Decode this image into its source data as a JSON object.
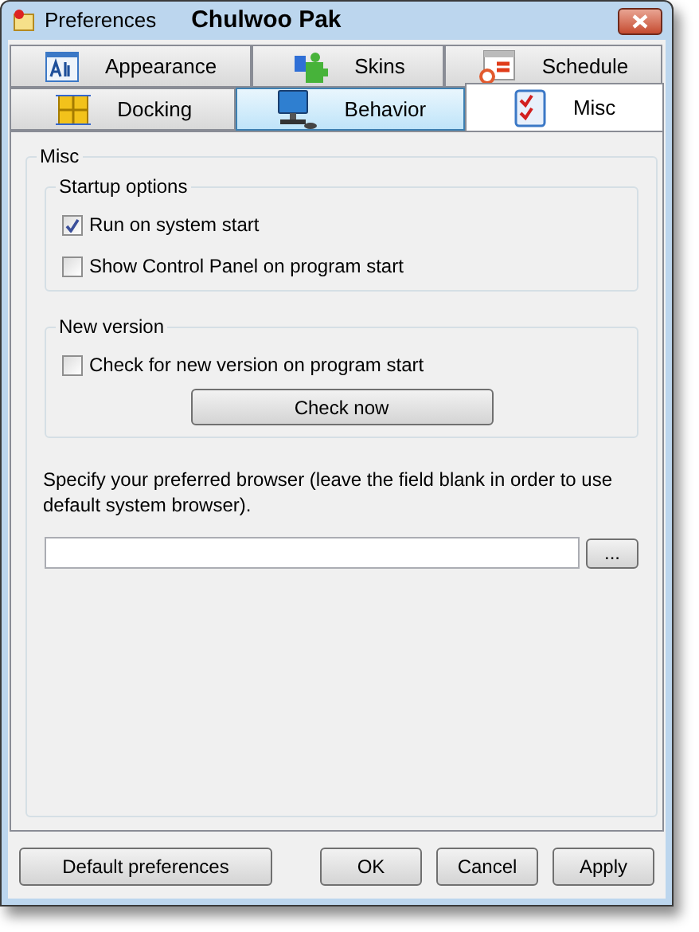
{
  "window": {
    "title": "Preferences",
    "caption": "Chulwoo Pak"
  },
  "tab_rows": [
    [
      {
        "label": "Appearance",
        "selected": false,
        "highlighted": false
      },
      {
        "label": "Skins",
        "selected": false,
        "highlighted": false
      },
      {
        "label": "Schedule",
        "selected": false,
        "highlighted": false
      }
    ],
    [
      {
        "label": "Docking",
        "selected": false,
        "highlighted": false
      },
      {
        "label": "Behavior",
        "selected": false,
        "highlighted": true
      },
      {
        "label": "Misc",
        "selected": true,
        "highlighted": false
      }
    ]
  ],
  "group": {
    "title": "Misc",
    "startup": {
      "title": "Startup options",
      "options": [
        {
          "label": "Run on system start",
          "checked": true
        },
        {
          "label": "Show Control Panel on program start",
          "checked": false
        }
      ]
    },
    "new_version": {
      "title": "New version",
      "options": [
        {
          "label": "Check for new version on program start",
          "checked": false
        }
      ],
      "button": "Check now"
    },
    "browser_hint": "Specify your preferred browser (leave the field blank in order to use default system browser).",
    "browse_button": "..."
  },
  "footer": {
    "default_button": "Default preferences",
    "buttons": [
      "OK",
      "Cancel",
      "Apply"
    ]
  }
}
